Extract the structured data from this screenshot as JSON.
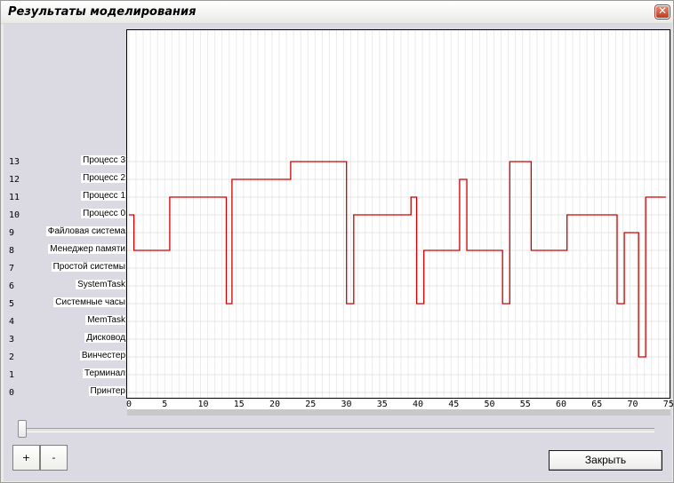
{
  "window": {
    "title": "Результаты моделирования",
    "close_glyph": "✕"
  },
  "rows": [
    {
      "num": "13",
      "name": "Процесс 3"
    },
    {
      "num": "12",
      "name": "Процесс 2"
    },
    {
      "num": "11",
      "name": "Процесс 1"
    },
    {
      "num": "10",
      "name": "Процесс 0"
    },
    {
      "num": "9",
      "name": "Файловая система"
    },
    {
      "num": "8",
      "name": "Менеджер памяти"
    },
    {
      "num": "7",
      "name": "Простой системы"
    },
    {
      "num": "6",
      "name": "SystemTask"
    },
    {
      "num": "5",
      "name": "Системные часы"
    },
    {
      "num": "4",
      "name": "MemTask"
    },
    {
      "num": "3",
      "name": "Дисковод"
    },
    {
      "num": "2",
      "name": "Винчестер"
    },
    {
      "num": "1",
      "name": "Терминал"
    },
    {
      "num": "0",
      "name": "Принтер"
    }
  ],
  "chart_data": {
    "type": "line",
    "step": true,
    "x_ticks": [
      "0",
      "5",
      "10",
      "15",
      "20",
      "25",
      "30",
      "35",
      "40",
      "45",
      "50",
      "55",
      "60",
      "65",
      "70",
      "75"
    ],
    "xlim": [
      0,
      75
    ],
    "ylim": [
      0,
      13
    ],
    "grid": true,
    "series": [
      {
        "color": "#cc0000",
        "points": [
          [
            0,
            10
          ],
          [
            0.7,
            10
          ],
          [
            0.7,
            8
          ],
          [
            5.7,
            8
          ],
          [
            5.7,
            11
          ],
          [
            13.6,
            11
          ],
          [
            13.6,
            5
          ],
          [
            14.4,
            5
          ],
          [
            14.4,
            12
          ],
          [
            22.6,
            12
          ],
          [
            22.6,
            13
          ],
          [
            30.4,
            13
          ],
          [
            30.4,
            5
          ],
          [
            31.4,
            5
          ],
          [
            31.4,
            10
          ],
          [
            39.4,
            10
          ],
          [
            39.4,
            11
          ],
          [
            40.2,
            11
          ],
          [
            40.2,
            5
          ],
          [
            41.2,
            5
          ],
          [
            41.2,
            8
          ],
          [
            46.2,
            8
          ],
          [
            46.2,
            12
          ],
          [
            47.2,
            12
          ],
          [
            47.2,
            8
          ],
          [
            52.2,
            8
          ],
          [
            52.2,
            5
          ],
          [
            53.2,
            5
          ],
          [
            53.2,
            13
          ],
          [
            56.2,
            13
          ],
          [
            56.2,
            8
          ],
          [
            61.2,
            8
          ],
          [
            61.2,
            10
          ],
          [
            68.2,
            10
          ],
          [
            68.2,
            5
          ],
          [
            69.2,
            5
          ],
          [
            69.2,
            9
          ],
          [
            71.2,
            9
          ],
          [
            71.2,
            2
          ],
          [
            72.2,
            2
          ],
          [
            72.2,
            11
          ],
          [
            75,
            11
          ]
        ]
      }
    ]
  },
  "controls": {
    "slider_value": 0,
    "plus_label": "+",
    "minus_label": "-",
    "close_label": "Закрыть"
  }
}
